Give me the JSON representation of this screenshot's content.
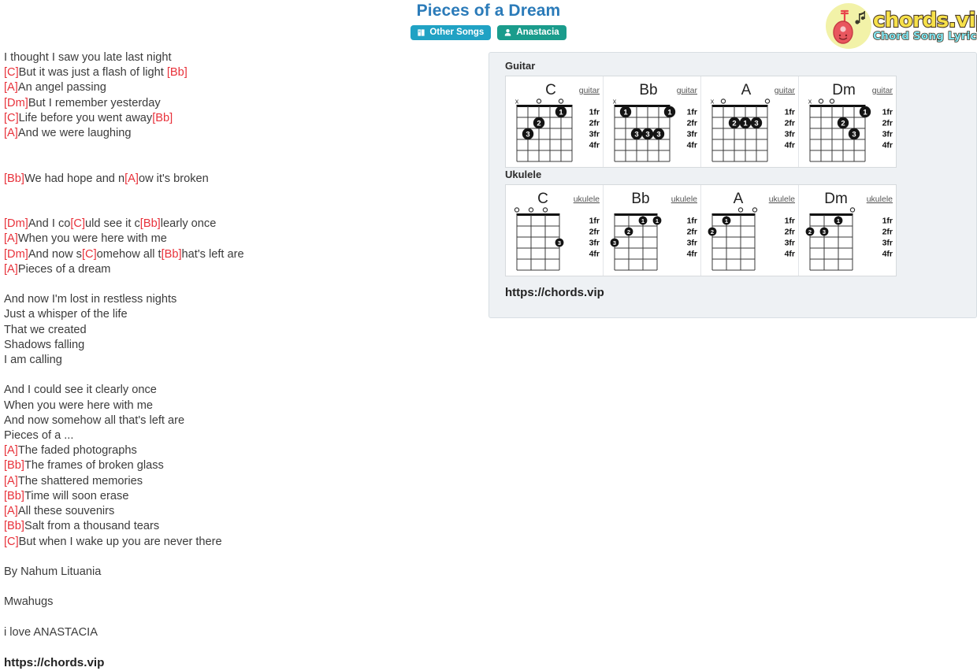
{
  "header": {
    "song_title": "Pieces of a Dream",
    "badges": [
      {
        "label": "Other Songs",
        "icon": "book-icon",
        "color": "#20a2c4"
      },
      {
        "label": "Anastacia",
        "icon": "user-icon",
        "color": "#1a9c8c"
      }
    ]
  },
  "logo": {
    "main": "chords.vip",
    "sub": "Chord Song Lyric",
    "icon": "guitar-icon",
    "circle_color": "#f2f2a8",
    "main_color": "#f7e14a",
    "sub_color": "#7fe3ef"
  },
  "lyrics": {
    "chord_color": "#e8313a",
    "lines": [
      [
        {
          "t": "text",
          "v": "I thought I saw you late last night"
        }
      ],
      [
        {
          "t": "chord",
          "v": "[C]"
        },
        {
          "t": "text",
          "v": "But it was just a flash of light "
        },
        {
          "t": "chord",
          "v": "[Bb]"
        }
      ],
      [
        {
          "t": "chord",
          "v": "[A]"
        },
        {
          "t": "text",
          "v": "An angel passing"
        }
      ],
      [
        {
          "t": "chord",
          "v": "[Dm]"
        },
        {
          "t": "text",
          "v": "But I remember yesterday"
        }
      ],
      [
        {
          "t": "chord",
          "v": "[C]"
        },
        {
          "t": "text",
          "v": "Life before you went away"
        },
        {
          "t": "chord",
          "v": "[Bb]"
        }
      ],
      [
        {
          "t": "chord",
          "v": "[A]"
        },
        {
          "t": "text",
          "v": "And we were laughing"
        }
      ],
      [],
      [],
      [
        {
          "t": "chord",
          "v": "[Bb]"
        },
        {
          "t": "text",
          "v": "We had hope and n"
        },
        {
          "t": "chord",
          "v": "[A]"
        },
        {
          "t": "text",
          "v": "ow it's broken"
        }
      ],
      [],
      [],
      [
        {
          "t": "chord",
          "v": "[Dm]"
        },
        {
          "t": "text",
          "v": "And I co"
        },
        {
          "t": "chord",
          "v": "[C]"
        },
        {
          "t": "text",
          "v": "uld see it c"
        },
        {
          "t": "chord",
          "v": "[Bb]"
        },
        {
          "t": "text",
          "v": "learly once"
        }
      ],
      [
        {
          "t": "chord",
          "v": "[A]"
        },
        {
          "t": "text",
          "v": "When you were here with me"
        }
      ],
      [
        {
          "t": "chord",
          "v": "[Dm]"
        },
        {
          "t": "text",
          "v": "And now s"
        },
        {
          "t": "chord",
          "v": "[C]"
        },
        {
          "t": "text",
          "v": "omehow all t"
        },
        {
          "t": "chord",
          "v": "[Bb]"
        },
        {
          "t": "text",
          "v": "hat's left are"
        }
      ],
      [
        {
          "t": "chord",
          "v": "[A]"
        },
        {
          "t": "text",
          "v": "Pieces of a dream"
        }
      ],
      [],
      [
        {
          "t": "text",
          "v": "And now I'm lost in restless nights"
        }
      ],
      [
        {
          "t": "text",
          "v": "Just a whisper of the life"
        }
      ],
      [
        {
          "t": "text",
          "v": "That we created"
        }
      ],
      [
        {
          "t": "text",
          "v": "Shadows falling"
        }
      ],
      [
        {
          "t": "text",
          "v": "I am calling"
        }
      ],
      [],
      [
        {
          "t": "text",
          "v": "And I could see it clearly once"
        }
      ],
      [
        {
          "t": "text",
          "v": "When you were here with me"
        }
      ],
      [
        {
          "t": "text",
          "v": "And now somehow all that's left are"
        }
      ],
      [
        {
          "t": "text",
          "v": "Pieces of a ..."
        }
      ],
      [
        {
          "t": "chord",
          "v": "[A]"
        },
        {
          "t": "text",
          "v": "The faded photographs"
        }
      ],
      [
        {
          "t": "chord",
          "v": "[Bb]"
        },
        {
          "t": "text",
          "v": "The frames of broken glass"
        }
      ],
      [
        {
          "t": "chord",
          "v": "[A]"
        },
        {
          "t": "text",
          "v": "The shattered memories"
        }
      ],
      [
        {
          "t": "chord",
          "v": "[Bb]"
        },
        {
          "t": "text",
          "v": "Time will soon erase"
        }
      ],
      [
        {
          "t": "chord",
          "v": "[A]"
        },
        {
          "t": "text",
          "v": "All these souvenirs"
        }
      ],
      [
        {
          "t": "chord",
          "v": "[Bb]"
        },
        {
          "t": "text",
          "v": "Salt from a thousand tears"
        }
      ],
      [
        {
          "t": "chord",
          "v": "[C]"
        },
        {
          "t": "text",
          "v": "But when I wake up you are never there"
        }
      ],
      [],
      [
        {
          "t": "text",
          "v": "By Nahum Lituania"
        }
      ],
      [],
      [
        {
          "t": "text",
          "v": "Mwahugs"
        }
      ],
      [],
      [
        {
          "t": "text",
          "v": "i love ANASTACIA"
        }
      ],
      [],
      [
        {
          "t": "bold",
          "v": "https://chords.vip"
        }
      ]
    ]
  },
  "chord_panel": {
    "url": "https://chords.vip",
    "fret_labels": [
      "1fr",
      "2fr",
      "3fr",
      "4fr"
    ],
    "sections": [
      {
        "label": "Guitar",
        "instrument_tag": "guitar",
        "strings": 6,
        "chords": [
          {
            "name": "C",
            "tag": "guitar",
            "markers": [
              "x",
              "",
              "o",
              "",
              "o",
              ""
            ],
            "dots": [
              {
                "string": 2,
                "fret": 1,
                "finger": "1"
              },
              {
                "string": 4,
                "fret": 2,
                "finger": "2"
              },
              {
                "string": 5,
                "fret": 3,
                "finger": "3"
              }
            ]
          },
          {
            "name": "Bb",
            "tag": "guitar",
            "markers": [
              "x",
              "",
              "",
              "",
              "",
              ""
            ],
            "dots": [
              {
                "string": 5,
                "fret": 1,
                "finger": "1"
              },
              {
                "string": 1,
                "fret": 1,
                "finger": "1"
              },
              {
                "string": 4,
                "fret": 3,
                "finger": "3"
              },
              {
                "string": 3,
                "fret": 3,
                "finger": "3"
              },
              {
                "string": 2,
                "fret": 3,
                "finger": "3"
              }
            ]
          },
          {
            "name": "A",
            "tag": "guitar",
            "markers": [
              "x",
              "o",
              "",
              "",
              "",
              "o"
            ],
            "dots": [
              {
                "string": 4,
                "fret": 2,
                "finger": "2"
              },
              {
                "string": 3,
                "fret": 2,
                "finger": "1"
              },
              {
                "string": 2,
                "fret": 2,
                "finger": "3"
              }
            ]
          },
          {
            "name": "Dm",
            "tag": "guitar",
            "markers": [
              "x",
              "o",
              "o",
              "",
              "",
              ""
            ],
            "dots": [
              {
                "string": 1,
                "fret": 1,
                "finger": "1"
              },
              {
                "string": 3,
                "fret": 2,
                "finger": "2"
              },
              {
                "string": 2,
                "fret": 3,
                "finger": "3"
              }
            ]
          }
        ]
      },
      {
        "label": "Ukulele",
        "instrument_tag": "ukulele",
        "strings": 4,
        "chords": [
          {
            "name": "C",
            "tag": "ukulele",
            "markers": [
              "o",
              "o",
              "o",
              ""
            ],
            "dots": [
              {
                "string": 1,
                "fret": 3,
                "finger": "3"
              }
            ]
          },
          {
            "name": "Bb",
            "tag": "ukulele",
            "markers": [
              "",
              "",
              "",
              ""
            ],
            "dots": [
              {
                "string": 2,
                "fret": 1,
                "finger": "1"
              },
              {
                "string": 1,
                "fret": 1,
                "finger": "1"
              },
              {
                "string": 3,
                "fret": 2,
                "finger": "2"
              },
              {
                "string": 4,
                "fret": 3,
                "finger": "3"
              }
            ]
          },
          {
            "name": "A",
            "tag": "ukulele",
            "markers": [
              "",
              "",
              "o",
              "o"
            ],
            "dots": [
              {
                "string": 3,
                "fret": 1,
                "finger": "1"
              },
              {
                "string": 4,
                "fret": 2,
                "finger": "2"
              }
            ]
          },
          {
            "name": "Dm",
            "tag": "ukulele",
            "markers": [
              "",
              "",
              "",
              "o"
            ],
            "dots": [
              {
                "string": 2,
                "fret": 1,
                "finger": "1"
              },
              {
                "string": 4,
                "fret": 2,
                "finger": "2"
              },
              {
                "string": 3,
                "fret": 2,
                "finger": "3"
              }
            ]
          }
        ]
      }
    ]
  },
  "footer": {
    "url": "https://chords.vip"
  }
}
